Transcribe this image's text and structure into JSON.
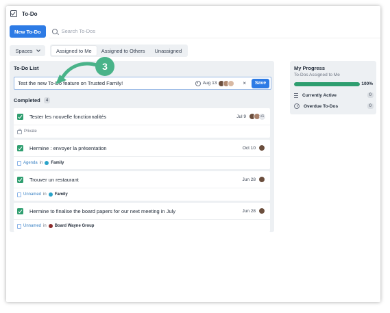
{
  "app": {
    "title": "To-Do"
  },
  "toolbar": {
    "new_button": "New To-Do",
    "search_placeholder": "Search To-Dos"
  },
  "filters": {
    "spaces_label": "Spaces",
    "tabs": [
      {
        "label": "Assigned to Me",
        "active": true
      },
      {
        "label": "Assigned to Others",
        "active": false
      },
      {
        "label": "Unassigned",
        "active": false
      }
    ]
  },
  "todo_list": {
    "title": "To-Do List",
    "new_item": {
      "text": "Test the new To-Do feature on Trusted Family!",
      "date": "Aug 13",
      "save_label": "Save",
      "cancel_symbol": "×"
    },
    "completed_label": "Completed",
    "completed_count": "4",
    "items": [
      {
        "title": "Tester les nouvelle fonctionnalités",
        "date": "Jul 9",
        "extra": "+1",
        "sub_private": "Private"
      },
      {
        "title": "Hermine : envoyer la présentation",
        "date": "Oct 10",
        "sub_link": "Agenda",
        "sub_in": "in",
        "sub_space": "Family",
        "space_color": "#2aa3c9"
      },
      {
        "title": "Trouver un restaurant",
        "date": "Jun 28",
        "sub_link": "Unnamed",
        "sub_in": "in",
        "sub_space": "Family",
        "space_color": "#2aa3c9"
      },
      {
        "title": "Hermine to finalise the board papers for our next meeting in July",
        "date": "Jun 28",
        "sub_link": "Unnamed",
        "sub_in": "in",
        "sub_space": "Board Wayne Group",
        "space_color": "#8b2b2b"
      }
    ]
  },
  "progress": {
    "title": "My Progress",
    "subtitle": "To-Dos Assigned to Me",
    "percent": 100,
    "percent_label": "100%",
    "currently_active_label": "Currently Active",
    "currently_active_count": "0",
    "overdue_label": "Overdue To-Dos",
    "overdue_count": "0"
  },
  "annotation": {
    "step": "3"
  },
  "colors": {
    "accent": "#2d7be5",
    "success": "#2e9e6f",
    "callout": "#49b389"
  }
}
